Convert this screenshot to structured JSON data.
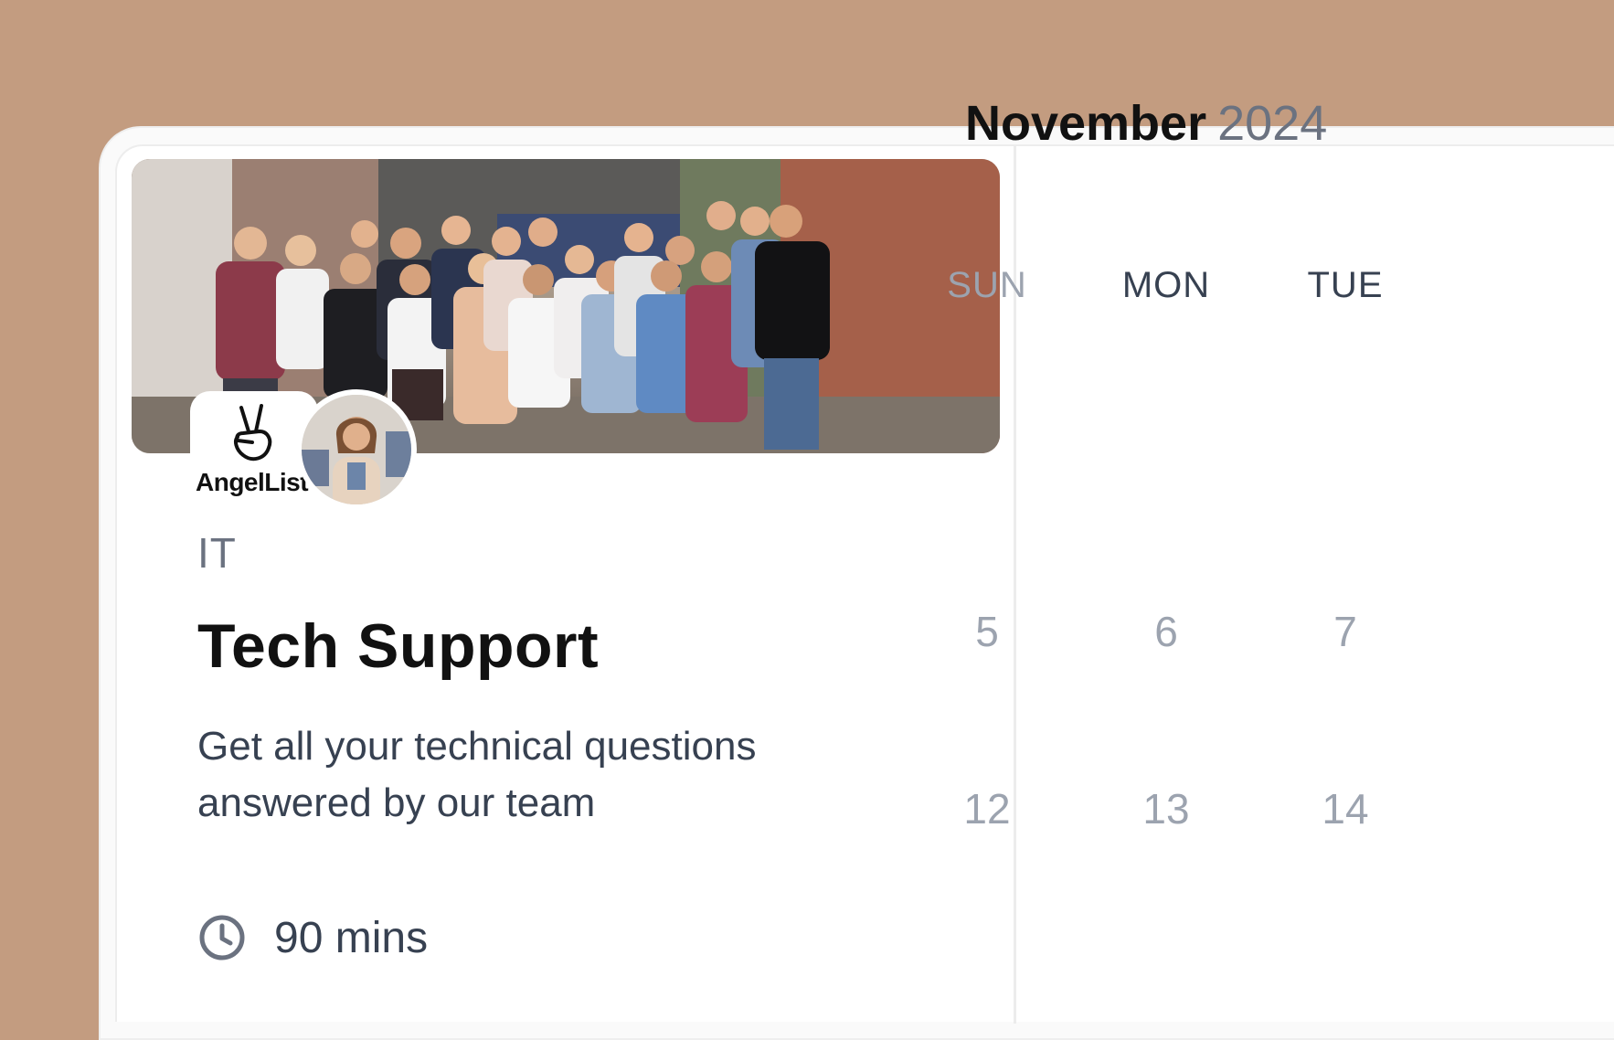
{
  "event": {
    "company_name": "AngelList",
    "category": "IT",
    "title": "Tech Support",
    "description": "Get all your technical questions answered by our team",
    "duration": "90 mins",
    "icons": {
      "company_logo": "peace-hand-icon",
      "duration": "clock-icon"
    }
  },
  "calendar": {
    "month": "November",
    "year": "2024",
    "weekdays": [
      "SUN",
      "MON",
      "TUE"
    ],
    "weeks": [
      [
        "5",
        "6",
        "7"
      ],
      [
        "12",
        "13",
        "14"
      ]
    ]
  },
  "colors": {
    "background": "#c39c80",
    "card": "#ffffff",
    "text_primary": "#111111",
    "text_secondary": "#6b7280",
    "text_muted": "#9ca3af"
  }
}
